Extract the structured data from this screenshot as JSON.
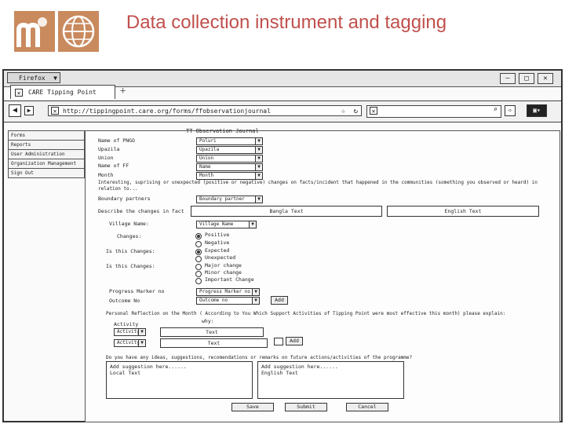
{
  "slide": {
    "title": "Data collection instrument and tagging",
    "logo_letter": "m"
  },
  "browser": {
    "menu_button": "Firefox",
    "tab_title": "CARE Tipping Point",
    "new_tab": "+",
    "url": "http://tippingpoint.care.org/forms/ffobservationjournal",
    "window_controls": [
      "—",
      "□",
      "✕"
    ]
  },
  "sidebar": {
    "items": [
      "Forms",
      "Reports",
      "User Administration",
      "Organization Management",
      "Sign Out"
    ]
  },
  "form": {
    "title": "TT Observation Journal",
    "fields": [
      {
        "label": "Name of PNGO",
        "value": "Poluri"
      },
      {
        "label": "Upazila",
        "value": "Upazila"
      },
      {
        "label": "Union",
        "value": "Union"
      },
      {
        "label": "Name of FF",
        "value": "Name"
      },
      {
        "label": "Month",
        "value": "Month"
      }
    ],
    "question": "Interesting, suprising or unexpected (positive or negative) changes on facts/incident that happened in the communities (something you observed or heard) in relation to...",
    "boundary_label": "Boundary partners",
    "boundary_value": "Boundary partner",
    "describe_label": "Describe the changes in fact",
    "bangla_header": "Bangla Text",
    "english_header": "English Text",
    "village_label": "Village Name:",
    "village_value": "Village Name",
    "changes_label": "Changes:",
    "changes_options": [
      "Positive",
      "Negative"
    ],
    "expected_label": "Is this Changes:",
    "expected_options": [
      "Expected",
      "Unexpected"
    ],
    "major_label": "Is this Changes:",
    "major_options": [
      "Major change",
      "Minor change",
      "Important Change"
    ],
    "progress_label": "Progress Marker no",
    "progress_value": "Progress Marker no",
    "outcome_label": "Outcome No",
    "outcome_value": "Outcome no",
    "add_label": "Add",
    "reflection": "Personal Reflection on the Month ( According to You Which Support Activities of Tipping Point were most effective this month) please explain:",
    "why_label": "why:",
    "activity_label": "Activity",
    "activity_rows": [
      {
        "value": "Activity",
        "text": "Text"
      },
      {
        "value": "Activity",
        "text": "Text"
      }
    ],
    "ideas": "Do you have any ideas, suggestions, recomendations or remarks on future actions/activities of the programme?",
    "suggestion_left": [
      "Add suggestion here......",
      "Local Text"
    ],
    "suggestion_right": [
      "Add suggestion here......",
      "English Text"
    ],
    "buttons": [
      "Save",
      "Submit",
      "Cancel"
    ]
  },
  "colors": {
    "title": "#c0504d",
    "logo": "#c98a5e"
  }
}
